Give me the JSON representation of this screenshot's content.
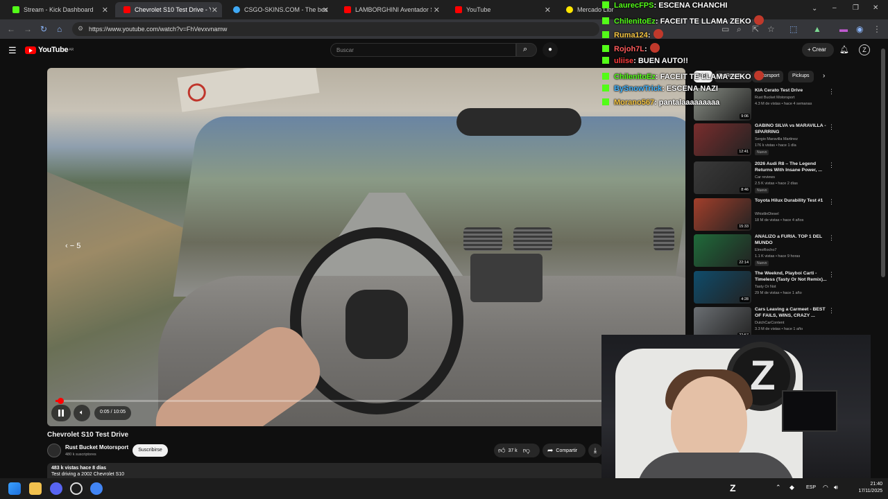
{
  "browser": {
    "tabs": [
      {
        "label": "Stream - Kick Dashboard",
        "color": "#53fc18",
        "active": false
      },
      {
        "label": "Chevrolet S10 Test Drive - Yo",
        "color": "#ff0000",
        "active": true
      },
      {
        "label": "CSGO-SKINS.COM - The best C",
        "color": "#3fa9f5",
        "active": false
      },
      {
        "label": "LAMBORGHINI Aventador SVJ",
        "color": "#ff0000",
        "active": false
      },
      {
        "label": "YouTube",
        "color": "#ff0000",
        "active": false
      },
      {
        "label": "Mercado Libr",
        "color": "#ffe600",
        "active": false
      }
    ],
    "url": "https://www.youtube.com/watch?v=FhVevxvnamw"
  },
  "youtube": {
    "logo": "YouTube",
    "region": "AR",
    "search_placeholder": "Buscar",
    "create_label": "Crear"
  },
  "player": {
    "time": "0:05 / 10:05",
    "progress_fraction": 0.008,
    "seek_hint": "5"
  },
  "video": {
    "title": "Chevrolet S10 Test Drive",
    "channel": "Rust Bucket Motorsport",
    "subscribers": "480 k suscriptores",
    "subscribe_label": "Suscribirse",
    "likes": "37 k",
    "share_label": "Compartir",
    "description_line1": "483 k vistas  hace 8 días",
    "description_line2": "Test driving a 2002 Chevrolet S10"
  },
  "sidebar": {
    "chips": [
      "Todo",
      "De Rust Bu...",
      "Motorsport",
      "Pickups"
    ],
    "recommendations": [
      {
        "title": "KIA Cerato Test Drive",
        "channel": "Rust Bucket Motorsport",
        "meta": "4.3 M de vistas • hace 4 semanas",
        "duration": "9:06",
        "badge": "",
        "thumb": "#8a8f86"
      },
      {
        "title": "GABINO SILVA vs MARAVILLA - SPARRING",
        "channel": "Sergio Maravilla Martinez",
        "meta": "176 k vistas • hace 1 día",
        "duration": "12:41",
        "badge": "Nuevo",
        "thumb": "#7a2d2d"
      },
      {
        "title": "2026 Audi R8 – The Legend Returns With Insane Power, ...",
        "channel": "Car reviews",
        "meta": "2.5 K vistas • hace 2 días",
        "duration": "8:46",
        "badge": "Nuevo",
        "thumb": "#3a3a3a"
      },
      {
        "title": "Toyota Hilux Durability Test #1",
        "channel": "WhistlinDiesel",
        "meta": "18 M de vistas • hace 4 años",
        "duration": "15:33",
        "badge": "",
        "thumb": "#a33f2b"
      },
      {
        "title": "ANALIZO a FURIA. TOP 1 DEL MUNDO",
        "channel": "ElmoRocho7",
        "meta": "1.1 K vistas • hace 9 horas",
        "duration": "22:14",
        "badge": "Nuevo",
        "thumb": "#1f6b3a"
      },
      {
        "title": "The Weeknd, Playboi Carti - Timeless (Tasty Or Not Remix)...",
        "channel": "Tasty Or Not",
        "meta": "29 M de vistas • hace 1 año",
        "duration": "4:28",
        "badge": "",
        "thumb": "#0f4c6b"
      },
      {
        "title": "Cars Leaving a Carmeet - BEST OF FAILS, WINS, CRAZY ...",
        "channel": "DutchCarContent",
        "meta": "3.3 M de vistas • hace 1 año",
        "duration": "22:57",
        "badge": "",
        "thumb": "#6b6f73"
      }
    ]
  },
  "chat": [
    {
      "user": "LaurecFPS",
      "color": "#53fc18",
      "text": ": ESCENA CHANCHI",
      "emote": false
    },
    {
      "user": "ChilenitoEz",
      "color": "#53fc18",
      "text": ": FACEIT TE LLAMA ZEKO",
      "emote": true
    },
    {
      "user": "Ruma124",
      "color": "#f5c542",
      "text": ":",
      "emote": true
    },
    {
      "user": "Rojoh7L",
      "color": "#ff5a5a",
      "text": ":",
      "emote": true
    },
    {
      "user": "uliise",
      "color": "#ff3b3b",
      "text": ": BUEN AUTO!!",
      "emote": false
    },
    {
      "user": "ChilenitoEz",
      "color": "#53fc18",
      "text": ": FACEIT TE LLAMA ZEKO",
      "emote": true
    },
    {
      "user": "BySnowTrick",
      "color": "#3fb4ff",
      "text": ": ESCENA NAZI",
      "emote": false
    },
    {
      "user": "Morano567",
      "color": "#f5c542",
      "text": ": pantalaaaaaaaaa",
      "emote": false
    }
  ],
  "taskbar": {
    "language": "ESP",
    "time": "21:40",
    "date": "17/11/2025"
  },
  "colors": {
    "yt_red": "#ff0000",
    "kick_green": "#53fc18",
    "background": "#0f0f0f"
  }
}
